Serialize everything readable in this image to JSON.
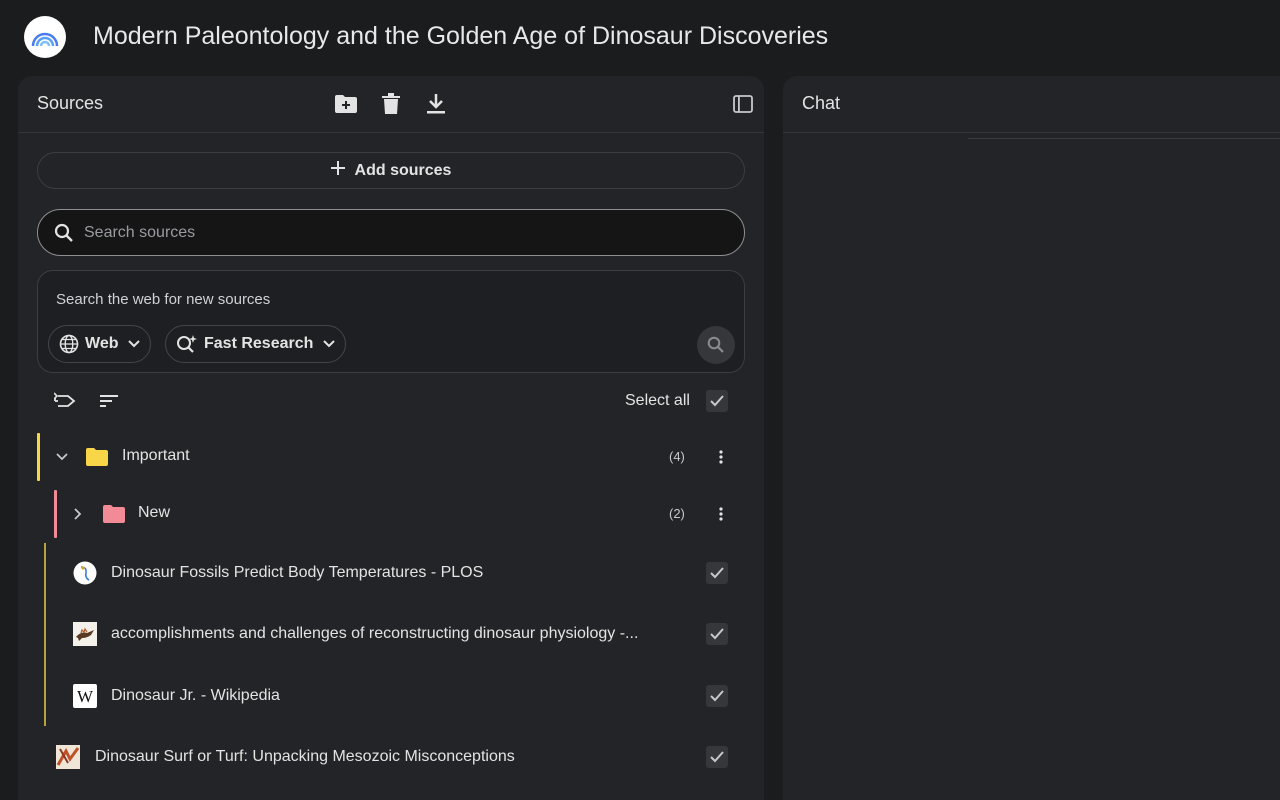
{
  "app": {
    "title": "Modern Paleontology and the Golden Age of Dinosaur Discoveries",
    "logo_icon": "notebook-logo-icon"
  },
  "sources_panel": {
    "title": "Sources",
    "toolbar_icons": [
      "add-folder-icon",
      "trash-icon",
      "download-icon",
      "collapse-panel-icon"
    ],
    "add_sources_label": "Add sources",
    "search": {
      "placeholder": "Search sources",
      "value": ""
    },
    "web_search": {
      "label": "Search the web for new sources",
      "source_chip": "Web",
      "mode_chip": "Fast Research"
    },
    "select_all_label": "Select all",
    "folders": [
      {
        "label": "Important",
        "count": "(4)",
        "color": "#f9d648",
        "expanded": true
      },
      {
        "label": "New",
        "count": "(2)",
        "color": "#f28b96",
        "expanded": false
      }
    ],
    "sources": [
      {
        "label": "Dinosaur Fossils Predict Body Temperatures - PLOS",
        "icon": "plos-icon",
        "checked": true
      },
      {
        "label": "accomplishments and challenges of reconstructing dinosaur physiology -...",
        "icon": "dinosaur-thumbnail-icon",
        "checked": true
      },
      {
        "label": "Dinosaur Jr. - Wikipedia",
        "icon": "wikipedia-icon",
        "checked": true
      },
      {
        "label": "Dinosaur Surf or Turf: Unpacking Mesozoic Misconceptions",
        "icon": "article-thumbnail-icon",
        "checked": true
      }
    ]
  },
  "chat_panel": {
    "title": "Chat"
  }
}
